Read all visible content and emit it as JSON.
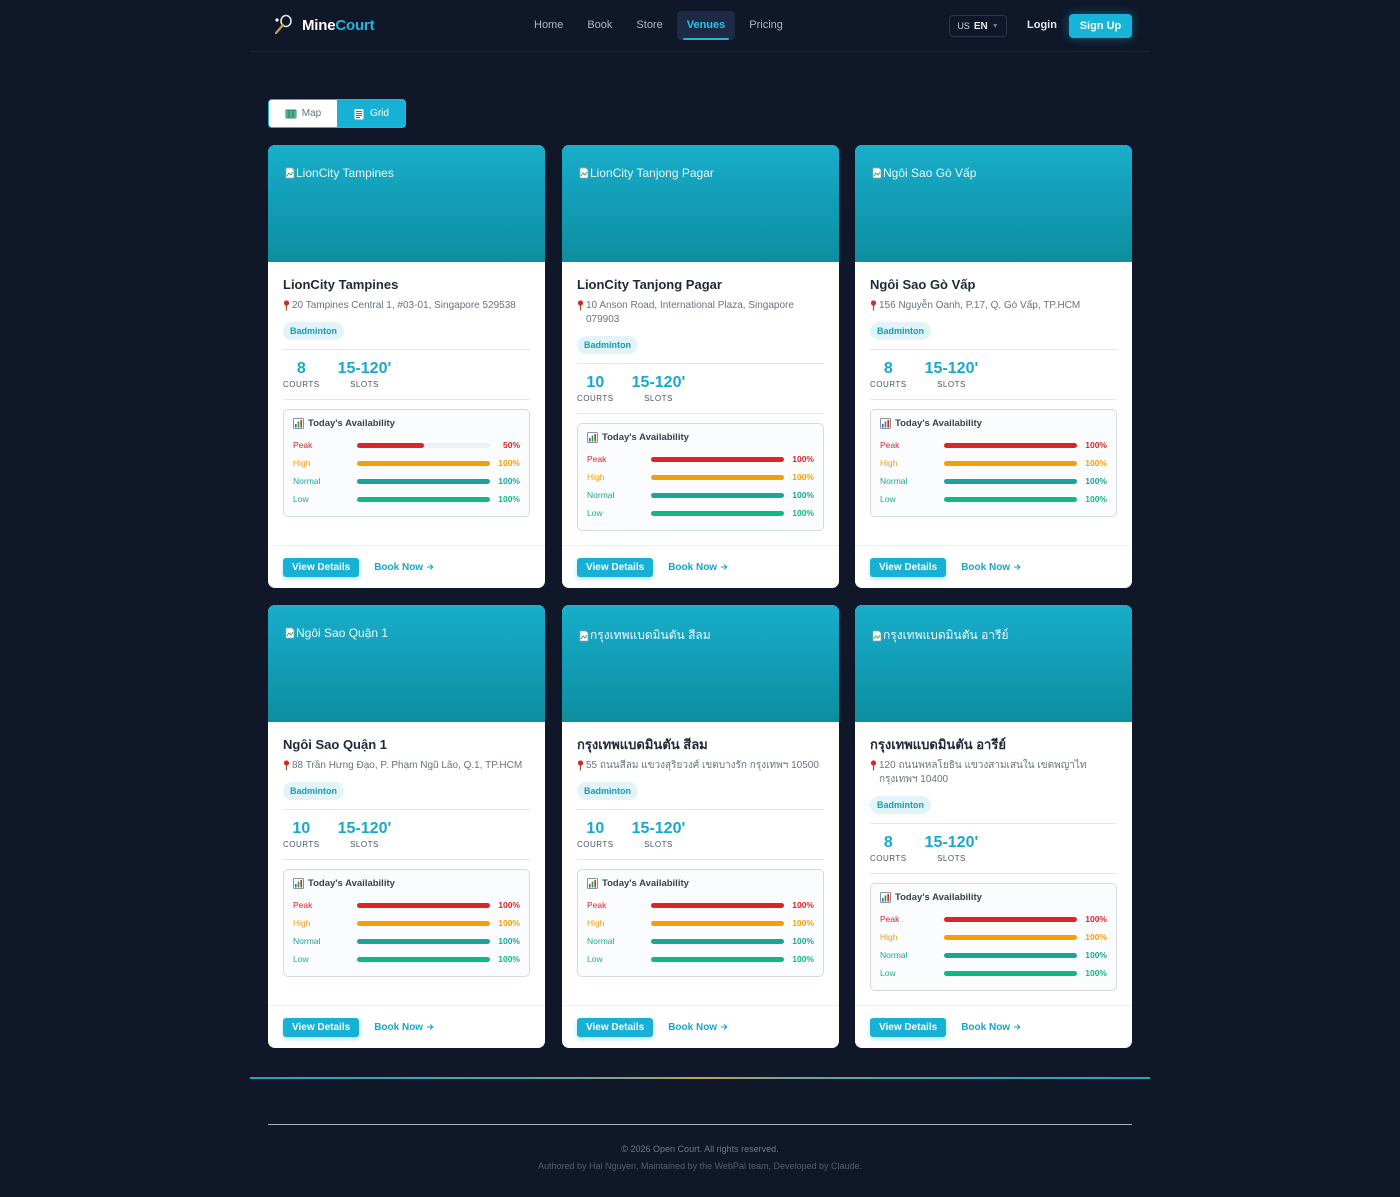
{
  "nav": {
    "brand_mine": "Mine",
    "brand_court": "Court",
    "links": [
      {
        "label": "Home",
        "active": false
      },
      {
        "label": "Book",
        "active": false
      },
      {
        "label": "Store",
        "active": false
      },
      {
        "label": "Venues",
        "active": true
      },
      {
        "label": "Pricing",
        "active": false
      }
    ],
    "lang_flag": "US",
    "lang_code": "EN",
    "login": "Login",
    "signup": "Sign Up"
  },
  "view_toggle": {
    "map": "Map",
    "grid": "Grid",
    "active": "grid"
  },
  "colors": {
    "peak": "#dc2626",
    "high": "#f59e0b",
    "normal": "#1ea39a",
    "low": "#10b981",
    "accent": "#16b1d5"
  },
  "common": {
    "courts_label": "COURTS",
    "slots_label": "SLOTS",
    "availability_title": "Today's Availability",
    "view_details": "View Details",
    "book_now": "Book Now",
    "tiers": [
      "Peak",
      "High",
      "Normal",
      "Low"
    ]
  },
  "venues": [
    {
      "image_alt": "LionCity Tampines",
      "name": "LionCity Tampines",
      "address": "20 Tampines Central 1, #03-01, Singapore 529538",
      "sport": "Badminton",
      "courts": "8",
      "slots": "15-120'",
      "availability": [
        {
          "pct_label": "50%",
          "fraction": 0.5
        },
        {
          "pct_label": "100%",
          "fraction": 1
        },
        {
          "pct_label": "100%",
          "fraction": 1
        },
        {
          "pct_label": "100%",
          "fraction": 1
        }
      ]
    },
    {
      "image_alt": "LionCity Tanjong Pagar",
      "name": "LionCity Tanjong Pagar",
      "address": "10 Anson Road, International Plaza, Singapore 079903",
      "sport": "Badminton",
      "courts": "10",
      "slots": "15-120'",
      "availability": [
        {
          "pct_label": "100%",
          "fraction": 1
        },
        {
          "pct_label": "100%",
          "fraction": 1
        },
        {
          "pct_label": "100%",
          "fraction": 1
        },
        {
          "pct_label": "100%",
          "fraction": 1
        }
      ]
    },
    {
      "image_alt": "Ngôi Sao Gò Vấp",
      "name": "Ngôi Sao Gò Vấp",
      "address": "156 Nguyễn Oanh, P.17, Q. Gò Vấp, TP.HCM",
      "sport": "Badminton",
      "courts": "8",
      "slots": "15-120'",
      "availability": [
        {
          "pct_label": "100%",
          "fraction": 1
        },
        {
          "pct_label": "100%",
          "fraction": 1
        },
        {
          "pct_label": "100%",
          "fraction": 1
        },
        {
          "pct_label": "100%",
          "fraction": 1
        }
      ]
    },
    {
      "image_alt": "Ngôi Sao Quận 1",
      "name": "Ngôi Sao Quận 1",
      "address": "88 Trần Hưng Đạo, P. Phạm Ngũ Lão, Q.1, TP.HCM",
      "sport": "Badminton",
      "courts": "10",
      "slots": "15-120'",
      "availability": [
        {
          "pct_label": "100%",
          "fraction": 1
        },
        {
          "pct_label": "100%",
          "fraction": 1
        },
        {
          "pct_label": "100%",
          "fraction": 1
        },
        {
          "pct_label": "100%",
          "fraction": 1
        }
      ]
    },
    {
      "image_alt": "กรุงเทพแบดมินตัน สีลม",
      "name": "กรุงเทพแบดมินตัน สีลม",
      "address": "55 ถนนสีลม แขวงสุริยวงศ์ เขตบางรัก กรุงเทพฯ 10500",
      "sport": "Badminton",
      "courts": "10",
      "slots": "15-120'",
      "availability": [
        {
          "pct_label": "100%",
          "fraction": 1
        },
        {
          "pct_label": "100%",
          "fraction": 1
        },
        {
          "pct_label": "100%",
          "fraction": 1
        },
        {
          "pct_label": "100%",
          "fraction": 1
        }
      ]
    },
    {
      "image_alt": "กรุงเทพแบดมินตัน อารีย์",
      "name": "กรุงเทพแบดมินตัน อารีย์",
      "address": "120 ถนนพหลโยธิน แขวงสามเสนใน เขตพญาไท กรุงเทพฯ 10400",
      "sport": "Badminton",
      "courts": "8",
      "slots": "15-120'",
      "availability": [
        {
          "pct_label": "100%",
          "fraction": 1
        },
        {
          "pct_label": "100%",
          "fraction": 1
        },
        {
          "pct_label": "100%",
          "fraction": 1
        },
        {
          "pct_label": "100%",
          "fraction": 1
        }
      ]
    }
  ],
  "footer": {
    "copyright": "© 2026 Open Court. All rights reserved.",
    "authored": "Authored by Hai Nguyen, Maintained by the WebPal team, Developed by Claude."
  }
}
